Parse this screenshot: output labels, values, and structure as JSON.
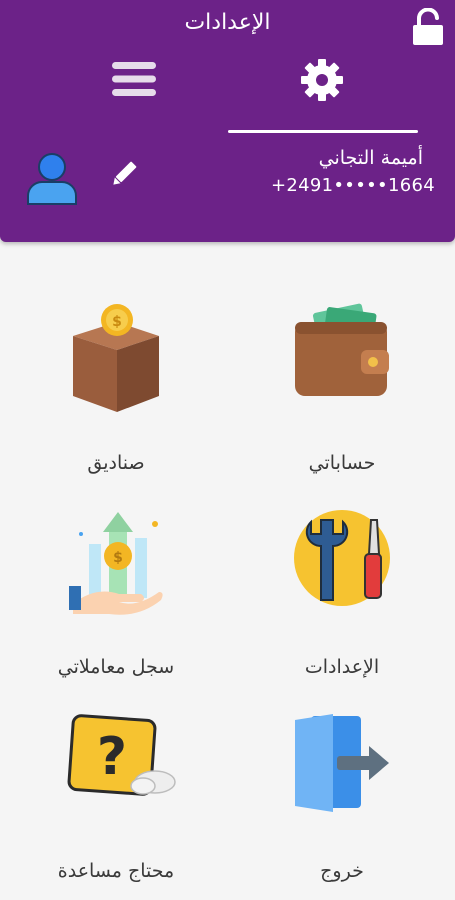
{
  "header": {
    "title": "الإعدادات",
    "user_name": "أميمة التجاني",
    "user_phone": "+2491•••••1664"
  },
  "menu": {
    "items": [
      {
        "label": "حساباتي",
        "icon": "wallet-icon"
      },
      {
        "label": "صناديق",
        "icon": "piggy-box-icon"
      },
      {
        "label": "الإعدادات",
        "icon": "tools-icon"
      },
      {
        "label": "سجل معاملاتي",
        "icon": "transaction-history-icon"
      },
      {
        "label": "خروج",
        "icon": "logout-door-icon"
      },
      {
        "label": "محتاج مساعدة",
        "icon": "help-question-icon"
      }
    ]
  },
  "colors": {
    "header_bg": "#6c2288",
    "page_bg": "#f5f5f5",
    "label_text": "#3a3a3a"
  }
}
